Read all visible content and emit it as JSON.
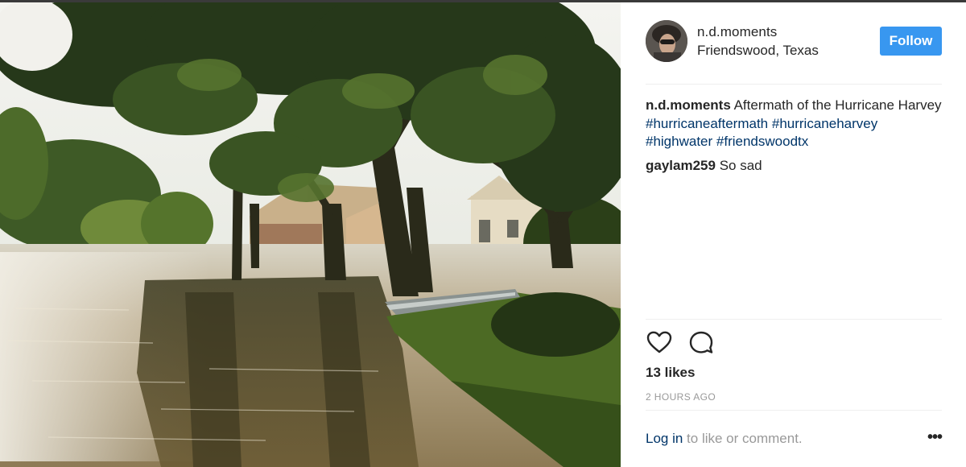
{
  "post": {
    "username": "n.d.moments",
    "location": "Friendswood, Texas",
    "follow_label": "Follow"
  },
  "caption": {
    "username": "n.d.moments",
    "text": "Aftermath of the Hurricane Harvey",
    "hashtags": [
      "#hurricaneaftermath",
      "#hurricaneharvey",
      "#highwater",
      "#friendswoodtx"
    ]
  },
  "comments": [
    {
      "username": "gaylam259",
      "text": "So sad"
    }
  ],
  "actions": {
    "like_icon": "heart-icon",
    "comment_icon": "speech-bubble-icon"
  },
  "likes": "13 likes",
  "timestamp": "2 HOURS AGO",
  "login": {
    "link": "Log in",
    "rest": " to like or comment.",
    "more_label": "•••"
  },
  "colors": {
    "follow_button": "#3897f0",
    "hashtag": "#003569",
    "muted": "#999999",
    "divider": "#efefef"
  }
}
